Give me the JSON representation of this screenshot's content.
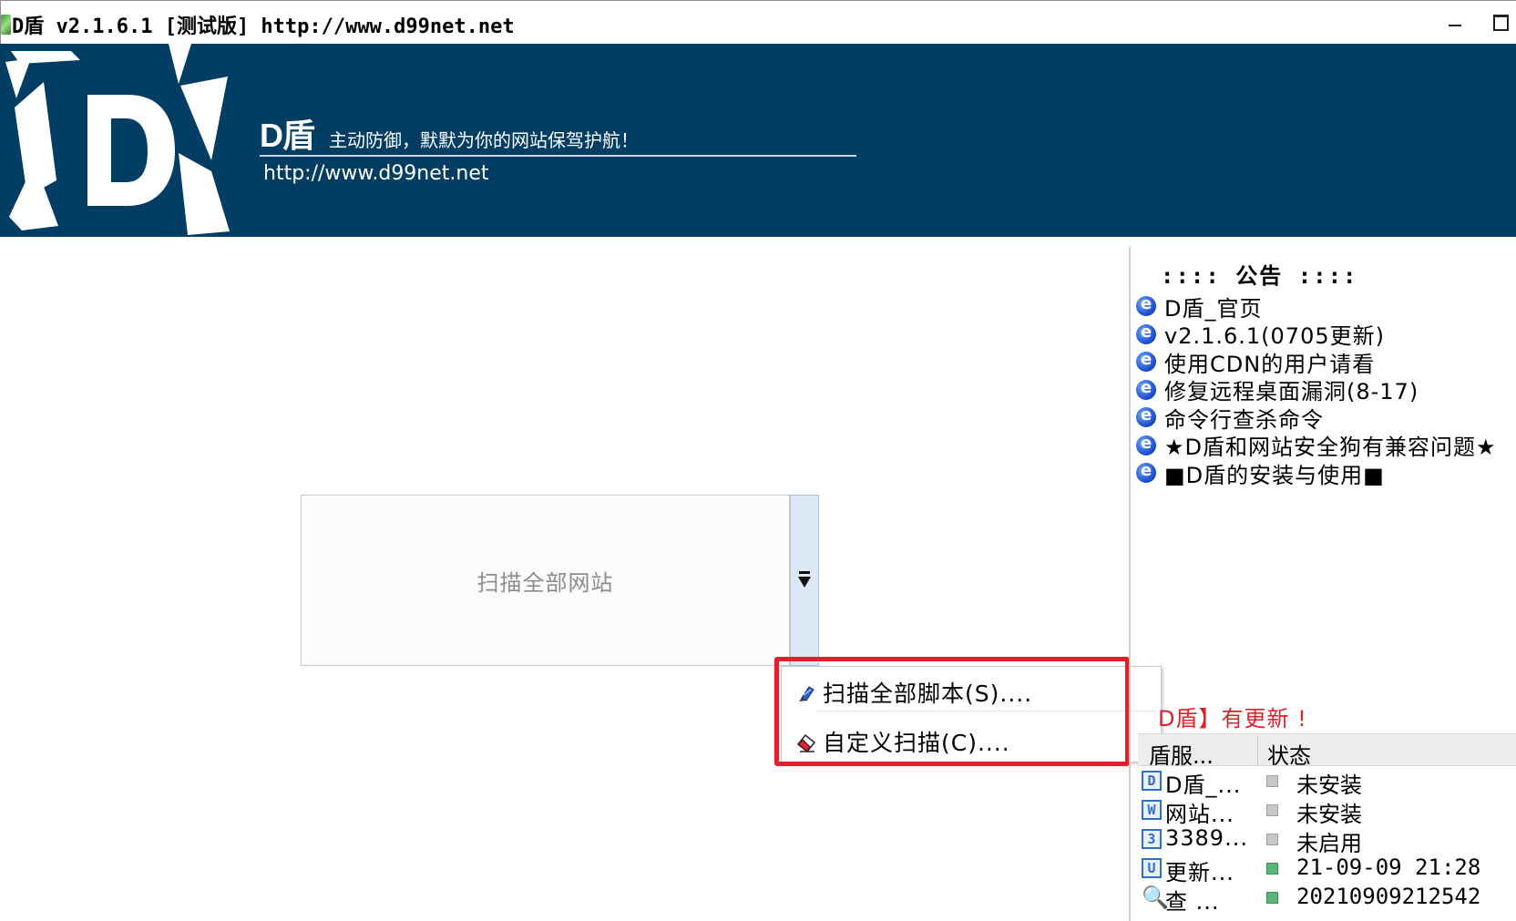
{
  "window": {
    "title": "D盾 v2.1.6.1 [测试版] http://www.d99net.net"
  },
  "banner": {
    "brand": "D盾",
    "slogan": "主动防御，默默为你的网站保驾护航！",
    "url": "http://www.d99net.net"
  },
  "scan_button": {
    "label": "扫描全部网站"
  },
  "menu": {
    "items": [
      {
        "label": "扫描全部脚本(S)....",
        "icon": "brush-icon"
      },
      {
        "label": "自定义扫描(C)....",
        "icon": "eraser-icon"
      }
    ]
  },
  "notice": {
    "title": ":::: 公告 ::::",
    "items": [
      {
        "label": "D盾_官页"
      },
      {
        "label": "v2.1.6.1(0705更新)"
      },
      {
        "label": "使用CDN的用户请看"
      },
      {
        "label": "修复远程桌面漏洞(8-17)"
      },
      {
        "label": "命令行查杀命令"
      },
      {
        "label": "★D盾和网站安全狗有兼容问题★"
      },
      {
        "label": "■D盾的安装与使用■"
      }
    ]
  },
  "update_notice": "D盾】有更新 !",
  "status_table": {
    "columns": [
      "盾服...",
      "状态"
    ],
    "rows": [
      {
        "icon": "D",
        "name": "D盾_...",
        "active": false,
        "status": "未安装"
      },
      {
        "icon": "W",
        "name": "网站...",
        "active": false,
        "status": "未安装"
      },
      {
        "icon": "3",
        "name": "3389...",
        "active": false,
        "status": "未启用"
      },
      {
        "icon": "U",
        "name": "更新...",
        "active": true,
        "status": "21-09-09 21:28"
      },
      {
        "icon": "🔍",
        "name": "查 ...",
        "active": true,
        "status": "20210909212542"
      }
    ]
  },
  "colors": {
    "banner_bg": "#023e63",
    "highlight": "#e0202b",
    "update_text": "#e0202b"
  }
}
